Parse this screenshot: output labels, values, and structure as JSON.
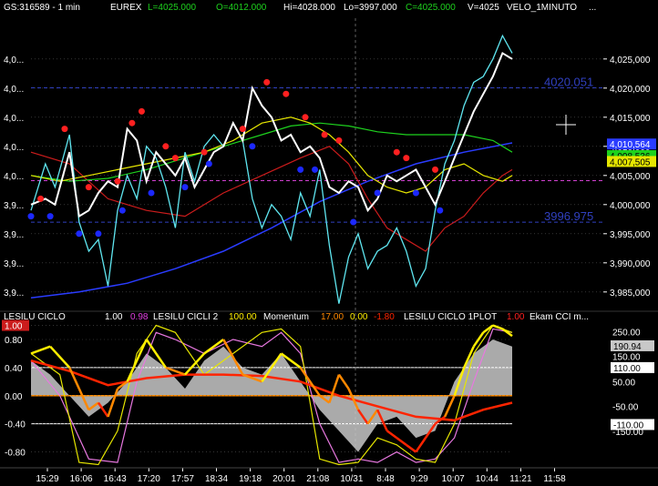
{
  "header": {
    "symbol": "GS:316589 - 1 min",
    "exchange": "EUREX",
    "last": "L=4025.000",
    "open": "O=4012.000",
    "high": "Hi=4028.000",
    "low": "Lo=3997.000",
    "close": "C=4025.000",
    "volume": "V=4025",
    "study": "VELO_1MINUTO",
    "more": "..."
  },
  "indicator_header": {
    "ciclo_name": "LESILU CICLO",
    "ciclo_val": "1.00",
    "ciclo_val2": "0.98",
    "ciclo2_name": "LESILU CICLI 2",
    "ciclo2_val": "100.00",
    "mom_name": "Momentum",
    "mom_val1": "17.00",
    "mom_val2": "0.00",
    "mom_val3": "-1.80",
    "plot_name": "LESILU CICLO 1PLOT",
    "plot_val": "1.00",
    "cci_name": "Ekam CCI m..."
  },
  "colors": {
    "background": "#000000",
    "price": "#ffffff",
    "cyan": "#5fe6f0",
    "blue_ma": "#2a3cff",
    "red_ma": "#cc1c1c",
    "yellow_ma": "#e6e600",
    "green_ma": "#1ed21e",
    "magenta_level": "#d040d0",
    "blue_level": "#3040c0",
    "grid": "#555555",
    "red_dot": "#ff2020",
    "blue_dot": "#1c28ff",
    "momentum_yellow": "#ffee00",
    "momentum_orange": "#ff8800",
    "momentum_red": "#ff2400",
    "cci_gray": "#c8c8c8",
    "pink_line": "#e878e0",
    "panel_zero": "#ff8c00"
  },
  "chart_data": [
    {
      "type": "line",
      "title": "GS:316589 - 1 min",
      "ylim": [
        3982,
        4032
      ],
      "y_ticks_left": [
        "4,0...",
        "4,0...",
        "4,0...",
        "4,0...",
        "4,0...",
        "3,9...",
        "3,9...",
        "3,9...",
        "3,9..."
      ],
      "y_ticks_right": [
        "4,025,000",
        "4,020,000",
        "4,015,000",
        "4,010,000",
        "4,005,000",
        "4,000,000",
        "3,995,000",
        "3,990,000",
        "3,985,000"
      ],
      "y_tick_values": [
        4025,
        4020,
        4015,
        4010,
        4005,
        4000,
        3995,
        3990,
        3985
      ],
      "levels": [
        {
          "value": 4020.051,
          "label": "4020.051",
          "color": "#3040c0"
        },
        {
          "value": 3996.975,
          "label": "3996.975",
          "color": "#3040c0"
        },
        {
          "value": 4004.1,
          "label": "",
          "color": "#d040d0"
        }
      ],
      "right_badges": [
        {
          "value": 4025,
          "text": "4,025,000",
          "bg": "#000000",
          "fg": "#ffffff"
        },
        {
          "value": 4010.4,
          "text": "4,010,564",
          "bg": "#2a3cff",
          "fg": "#ffffff"
        },
        {
          "value": 4008.4,
          "text": "4,008,536",
          "bg": "#1ed21e",
          "fg": "#000000"
        },
        {
          "value": 4007.4,
          "text": "4,007,505",
          "bg": "#e6e600",
          "fg": "#000000"
        }
      ],
      "x_range": [
        0,
        100
      ],
      "series": [
        {
          "key": "price",
          "x": [
            0,
            3,
            5,
            8,
            10,
            12,
            14,
            16,
            18,
            20,
            22,
            24,
            26,
            28,
            30,
            32,
            34,
            36,
            38,
            40,
            42,
            44,
            46,
            48,
            50,
            52,
            54,
            56,
            58,
            60,
            62,
            64,
            66,
            68,
            70,
            72,
            74,
            76,
            78,
            80,
            82,
            84,
            86,
            88,
            90,
            92,
            94,
            96,
            98,
            100
          ],
          "y": [
            4000,
            4001,
            4000,
            4009,
            3998,
            3999,
            4002,
            4004,
            4003,
            4013,
            4011,
            4004,
            4009,
            4007,
            4005,
            4008,
            4003,
            4006,
            4009,
            4010,
            4014,
            4011,
            4020,
            4017,
            4015,
            4011,
            4012,
            4009,
            4010,
            4008,
            4003,
            4002,
            4004,
            4003,
            3999,
            4001,
            4005,
            4004,
            4005,
            4006,
            4003,
            4000,
            4004,
            4008,
            4012,
            4016,
            4019,
            4022,
            4026,
            4025
          ]
        },
        {
          "key": "cyan",
          "x": [
            0,
            3,
            5,
            8,
            10,
            12,
            14,
            16,
            18,
            20,
            22,
            24,
            26,
            28,
            30,
            32,
            34,
            36,
            38,
            40,
            42,
            44,
            46,
            48,
            50,
            52,
            54,
            56,
            58,
            60,
            62,
            64,
            66,
            68,
            70,
            72,
            74,
            76,
            78,
            80,
            82,
            84,
            86,
            88,
            90,
            92,
            94,
            96,
            98,
            100
          ],
          "y": [
            3999,
            4007,
            4003,
            4012,
            3997,
            3992,
            3994,
            3986,
            3999,
            4005,
            4001,
            4010,
            4008,
            4003,
            3996,
            4009,
            4004,
            4010,
            4012,
            4010,
            4014,
            4011,
            4001,
            3996,
            4000,
            3998,
            3994,
            4002,
            3998,
            4006,
            3993,
            3983,
            3991,
            3995,
            3989,
            3992,
            3993,
            3996,
            3992,
            3986,
            3989,
            3999,
            4007,
            4011,
            4017,
            4021,
            4022,
            4025,
            4029,
            4026
          ]
        },
        {
          "key": "blue_ma",
          "x": [
            0,
            10,
            20,
            30,
            40,
            50,
            60,
            70,
            80,
            90,
            100
          ],
          "y": [
            3984,
            3985,
            3986.5,
            3989,
            3992,
            3996,
            4000.5,
            4004,
            4007,
            4009,
            4010.6
          ]
        },
        {
          "key": "red_ma",
          "x": [
            0,
            8,
            16,
            24,
            32,
            40,
            48,
            56,
            62,
            66,
            70,
            74,
            78,
            82,
            86,
            90,
            94,
            98,
            100
          ],
          "y": [
            4009,
            4007,
            4001,
            3999,
            3998,
            4002,
            4005,
            4008,
            4010,
            4007,
            4001,
            3996,
            3994,
            3992,
            3996,
            3998,
            4002,
            4005,
            4006
          ]
        },
        {
          "key": "yellow_ma",
          "x": [
            0,
            6,
            12,
            18,
            24,
            30,
            36,
            42,
            48,
            54,
            58,
            62,
            66,
            70,
            74,
            78,
            82,
            86,
            90,
            94,
            98,
            100
          ],
          "y": [
            4005,
            4004,
            4005,
            4006,
            4007,
            4008,
            4009,
            4011,
            4014,
            4015,
            4014,
            4012,
            4009,
            4005,
            4003,
            4002,
            4003,
            4006,
            4007,
            4005,
            4004,
            4005
          ]
        },
        {
          "key": "green_ma",
          "x": [
            0,
            8,
            16,
            24,
            32,
            40,
            48,
            54,
            60,
            66,
            72,
            78,
            84,
            90,
            96,
            100
          ],
          "y": [
            4005,
            4004,
            4004.5,
            4006,
            4008,
            4010,
            4012,
            4013.5,
            4014,
            4013.5,
            4012.5,
            4012,
            4012,
            4012,
            4011,
            4009
          ]
        }
      ],
      "red_dots": [
        {
          "x": 2,
          "y": 4001
        },
        {
          "x": 7,
          "y": 4013
        },
        {
          "x": 12,
          "y": 4003
        },
        {
          "x": 18,
          "y": 4004
        },
        {
          "x": 21,
          "y": 4014
        },
        {
          "x": 23,
          "y": 4016
        },
        {
          "x": 28,
          "y": 4010
        },
        {
          "x": 30,
          "y": 4008
        },
        {
          "x": 36,
          "y": 4009
        },
        {
          "x": 44,
          "y": 4013
        },
        {
          "x": 49,
          "y": 4021
        },
        {
          "x": 53,
          "y": 4019
        },
        {
          "x": 57,
          "y": 4015
        },
        {
          "x": 61,
          "y": 4012
        },
        {
          "x": 64,
          "y": 4011
        },
        {
          "x": 76,
          "y": 4009
        },
        {
          "x": 78,
          "y": 4008
        },
        {
          "x": 84,
          "y": 4006
        }
      ],
      "blue_dots": [
        {
          "x": 0,
          "y": 3998
        },
        {
          "x": 4,
          "y": 3998
        },
        {
          "x": 10,
          "y": 3995
        },
        {
          "x": 14,
          "y": 3995
        },
        {
          "x": 19,
          "y": 3999
        },
        {
          "x": 25,
          "y": 4002
        },
        {
          "x": 32,
          "y": 4003
        },
        {
          "x": 37,
          "y": 4007
        },
        {
          "x": 46,
          "y": 4010
        },
        {
          "x": 56,
          "y": 4006
        },
        {
          "x": 59,
          "y": 4006
        },
        {
          "x": 67,
          "y": 3997
        },
        {
          "x": 72,
          "y": 4002
        },
        {
          "x": 80,
          "y": 4002
        },
        {
          "x": 85,
          "y": 3999
        }
      ]
    },
    {
      "type": "line",
      "title": "LESILU CICLO",
      "ylim": [
        -1.0,
        1.02
      ],
      "y_ticks_left": [
        "1.00",
        "0.80",
        "0.40",
        "0.00",
        "-0.40",
        "-0.80"
      ],
      "y_tick_values_left": [
        1.0,
        0.8,
        0.4,
        0.0,
        -0.4,
        -0.8
      ],
      "y_ticks_right": [
        "250.00",
        "150.00",
        "50.00",
        "-50.00",
        "-150.00"
      ],
      "y_tick_values_right": [
        0.91,
        0.56,
        0.2,
        -0.15,
        -0.51
      ],
      "right_badges": [
        {
          "value": 0.71,
          "text": "190.94",
          "bg": "#c8c8c8",
          "fg": "#000000"
        },
        {
          "value": 0.4,
          "text": "110.00",
          "bg": "#ffffff",
          "fg": "#000000"
        },
        {
          "value": -0.41,
          "text": "-110.00",
          "bg": "#ffffff",
          "fg": "#000000"
        },
        {
          "value": 1.0,
          "text": "1.00",
          "bg": "#cc1c1c",
          "fg": "#ffffff"
        }
      ],
      "hlines": [
        0.4,
        -0.4
      ],
      "x_range": [
        0,
        100
      ],
      "series": [
        {
          "key": "cci",
          "x": [
            0,
            4,
            8,
            12,
            16,
            20,
            24,
            28,
            32,
            36,
            40,
            44,
            48,
            52,
            56,
            60,
            64,
            68,
            72,
            76,
            80,
            84,
            88,
            92,
            96,
            100
          ],
          "y": [
            0.5,
            0.3,
            0.0,
            -0.3,
            -0.1,
            0.2,
            0.6,
            0.4,
            0.1,
            0.5,
            0.7,
            0.4,
            0.3,
            0.6,
            0.2,
            -0.2,
            -0.5,
            -0.8,
            -0.4,
            -0.3,
            -0.6,
            -0.5,
            0.2,
            0.6,
            0.8,
            0.7
          ]
        },
        {
          "key": "red_curve",
          "x": [
            0,
            8,
            16,
            24,
            32,
            40,
            48,
            56,
            64,
            72,
            80,
            88,
            94,
            100
          ],
          "y": [
            0.5,
            0.35,
            0.15,
            0.25,
            0.3,
            0.3,
            0.28,
            0.2,
            0.0,
            -0.15,
            -0.3,
            -0.35,
            -0.2,
            -0.1
          ]
        },
        {
          "key": "pink_curve",
          "x": [
            0,
            6,
            12,
            18,
            22,
            26,
            30,
            36,
            42,
            48,
            52,
            56,
            60,
            64,
            68,
            72,
            76,
            80,
            84,
            88,
            92,
            96,
            100
          ],
          "y": [
            0.5,
            0.0,
            -0.9,
            -0.95,
            0.2,
            0.9,
            0.8,
            0.6,
            0.8,
            0.7,
            0.9,
            0.6,
            -0.4,
            -0.95,
            -0.9,
            -0.95,
            -0.8,
            -0.95,
            -0.9,
            -0.6,
            0.2,
            0.95,
            0.9
          ]
        },
        {
          "key": "yellow_curve",
          "x": [
            0,
            6,
            10,
            14,
            18,
            22,
            26,
            30,
            36,
            42,
            48,
            52,
            56,
            60,
            64,
            68,
            72,
            76,
            80,
            84,
            88,
            92,
            96,
            100
          ],
          "y": [
            0.6,
            0.3,
            -0.95,
            -0.98,
            -0.5,
            0.6,
            1.0,
            0.9,
            0.3,
            0.6,
            0.9,
            0.95,
            0.7,
            -0.9,
            -0.98,
            -0.95,
            -0.6,
            -0.7,
            -0.9,
            -0.95,
            -0.4,
            0.6,
            1.0,
            0.9
          ]
        },
        {
          "key": "momentum",
          "x": [
            0,
            4,
            8,
            10,
            12,
            14,
            16,
            18,
            20,
            24,
            28,
            32,
            36,
            40,
            44,
            48,
            52,
            56,
            60,
            62,
            64,
            66,
            68,
            70,
            72,
            74,
            76,
            78,
            80,
            82,
            84,
            86,
            88,
            90,
            92,
            94,
            96,
            98,
            100
          ],
          "y": [
            0.6,
            0.7,
            0.4,
            0.1,
            -0.2,
            -0.1,
            -0.3,
            0.1,
            0.2,
            0.8,
            0.4,
            0.3,
            0.6,
            0.8,
            0.3,
            0.2,
            0.6,
            0.4,
            0.0,
            -0.1,
            0.3,
            0.1,
            -0.2,
            -0.4,
            -0.2,
            -0.5,
            -0.6,
            -0.7,
            -0.8,
            -0.6,
            -0.4,
            -0.3,
            0.0,
            0.4,
            0.7,
            0.9,
            1.0,
            0.95,
            0.85
          ]
        }
      ]
    }
  ],
  "x_axis": {
    "labels": [
      "15:29",
      "16:06",
      "16:43",
      "17:20",
      "17:57",
      "18:34",
      "19:18",
      "20:01",
      "21:08",
      "10/31",
      "8:48",
      "9:29",
      "10:07",
      "10:44",
      "11:21",
      "11:58"
    ]
  }
}
